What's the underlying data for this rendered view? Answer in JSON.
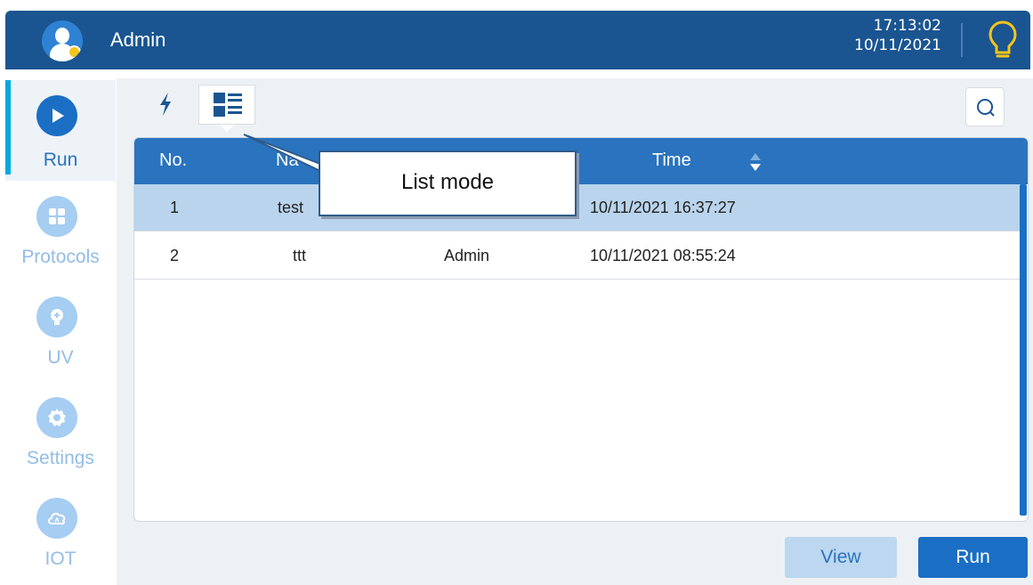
{
  "header": {
    "user_name": "Admin",
    "time": "17:13:02",
    "date": "10/11/2021",
    "icons": {
      "avatar": "user-avatar-icon",
      "status": "lightbulb-icon"
    }
  },
  "sidebar": {
    "items": [
      {
        "label": "Run",
        "icon": "play-icon",
        "active": true
      },
      {
        "label": "Protocols",
        "icon": "grid-icon",
        "active": false
      },
      {
        "label": "UV",
        "icon": "uv-lamp-icon",
        "active": false
      },
      {
        "label": "Settings",
        "icon": "gear-icon",
        "active": false
      },
      {
        "label": "IOT",
        "icon": "cloud-icon",
        "active": false
      }
    ]
  },
  "toolbar": {
    "quick_mode_icon": "lightning-icon",
    "list_mode_icon": "list-view-icon",
    "search_icon": "search-icon"
  },
  "table": {
    "columns": {
      "no": "No.",
      "name": "Na",
      "time": "Time"
    },
    "rows": [
      {
        "no": "1",
        "name": "test",
        "user": "",
        "time": "10/11/2021 16:37:27",
        "selected": true
      },
      {
        "no": "2",
        "name": "ttt",
        "user": "Admin",
        "time": "10/11/2021 08:55:24",
        "selected": false
      }
    ]
  },
  "callout": {
    "text": "List mode"
  },
  "buttons": {
    "view": "View",
    "run": "Run"
  },
  "colors": {
    "header_bg": "#1a5591",
    "accent": "#1a6fc4",
    "table_header": "#2a73be",
    "selected_row": "#b9d4ec",
    "nav_inactive": "#a6cdf2",
    "active_indicator": "#00a9e0"
  }
}
